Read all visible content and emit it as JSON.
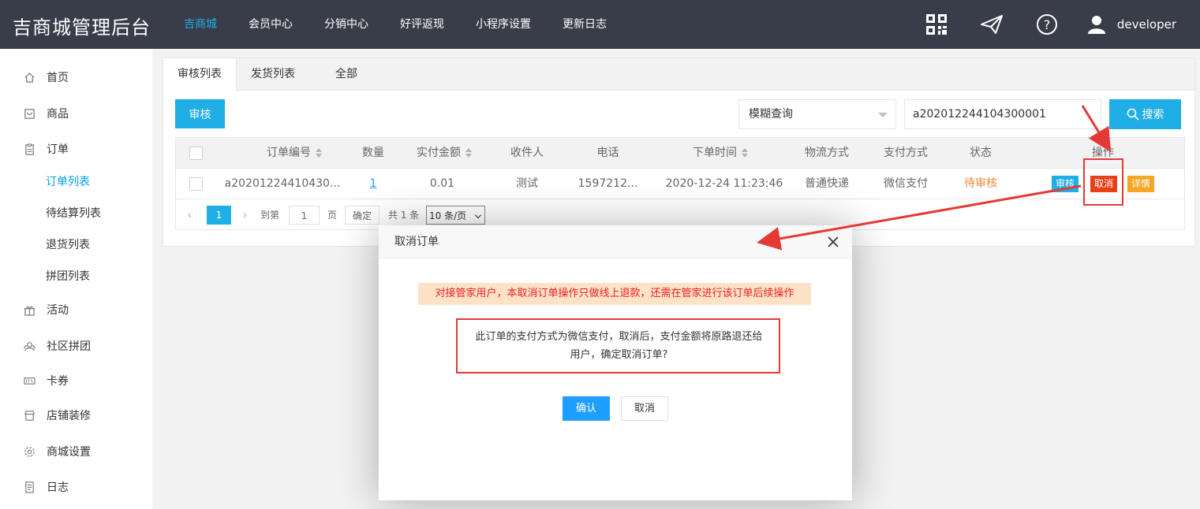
{
  "header": {
    "brand": "吉商城管理后台",
    "nav": [
      {
        "label": "吉商城",
        "active": true
      },
      {
        "label": "会员中心"
      },
      {
        "label": "分销中心"
      },
      {
        "label": "好评返现"
      },
      {
        "label": "小程序设置"
      },
      {
        "label": "更新日志"
      }
    ],
    "icons": [
      "qrcode-icon",
      "paper-plane-icon",
      "help-icon",
      "user-avatar-icon"
    ],
    "username": "developer"
  },
  "sidebar": {
    "items": [
      {
        "label": "首页",
        "icon": "home-icon"
      },
      {
        "label": "商品",
        "icon": "goods-icon"
      },
      {
        "label": "订单",
        "icon": "order-icon"
      },
      {
        "label": "订单列表",
        "active": true
      },
      {
        "label": "待结算列表"
      },
      {
        "label": "退货列表"
      },
      {
        "label": "拼团列表"
      },
      {
        "label": "活动",
        "icon": "gift-icon"
      },
      {
        "label": "社区拼团",
        "icon": "community-icon"
      },
      {
        "label": "卡券",
        "icon": "ticket-icon"
      },
      {
        "label": "店铺装修",
        "icon": "store-icon"
      },
      {
        "label": "商城设置",
        "icon": "settings-icon"
      },
      {
        "label": "日志",
        "icon": "log-icon"
      }
    ]
  },
  "tabs": [
    "审核列表",
    "发货列表",
    "全部"
  ],
  "toolbar": {
    "audit_label": "审核",
    "query_mode": "模糊查询",
    "search_value": "a202012244104300001",
    "search_label": "搜索"
  },
  "table": {
    "headers": [
      "订单编号",
      "数量",
      "实付金额",
      "收件人",
      "电话",
      "下单时间",
      "物流方式",
      "支付方式",
      "状态",
      "操作"
    ],
    "row": {
      "order_no": "a20201224410430...",
      "qty": "1",
      "amount": "0.01",
      "recipient": "测试",
      "phone": "1597212...",
      "time": "2020-12-24 11:23:46",
      "shipping": "普通快递",
      "payment": "微信支付",
      "status": "待审核",
      "ops": {
        "audit": "审核",
        "cancel": "取消",
        "detail": "详情"
      }
    }
  },
  "pager": {
    "current": "1",
    "goto_label": "到第",
    "page_value": "1",
    "page_unit": "页",
    "confirm": "确定",
    "total": "共 1 条",
    "page_size": "10 条/页"
  },
  "dialog": {
    "title": "取消订单",
    "warning": "对接管家用户，本取消订单操作只做线上退款，还需在管家进行该订单后续操作",
    "message_line1": "此订单的支付方式为微信支付，取消后，支付金额将原路退还给",
    "message_line2": "用户，确定取消订单?",
    "ok_label": "确认",
    "cancel_label": "取消"
  },
  "colors": {
    "header_bg": "#393d49",
    "accent": "#1faee5",
    "status_pending": "#f0883a",
    "btn_cancel": "#e8411a",
    "btn_detail": "#f5a623",
    "annotation_red": "#e53935"
  }
}
